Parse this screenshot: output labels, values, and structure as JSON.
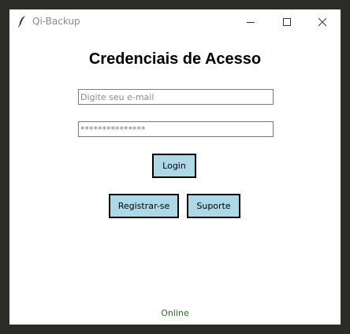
{
  "window": {
    "title": "Qi-Backup",
    "controls": {
      "minimize_icon": "minimize-icon",
      "maximize_icon": "maximize-icon",
      "close_icon": "close-icon"
    }
  },
  "form": {
    "heading": "Credenciais de Acesso",
    "email": {
      "value": "",
      "placeholder": "Digite seu e-mail"
    },
    "password": {
      "value": "***************"
    },
    "login_label": "Login",
    "register_label": "Registrar-se",
    "support_label": "Suporte"
  },
  "status": {
    "text": "Online",
    "color": "#1a7a1a"
  },
  "colors": {
    "button_bg": "#add8e6",
    "background": "#ffffff"
  }
}
